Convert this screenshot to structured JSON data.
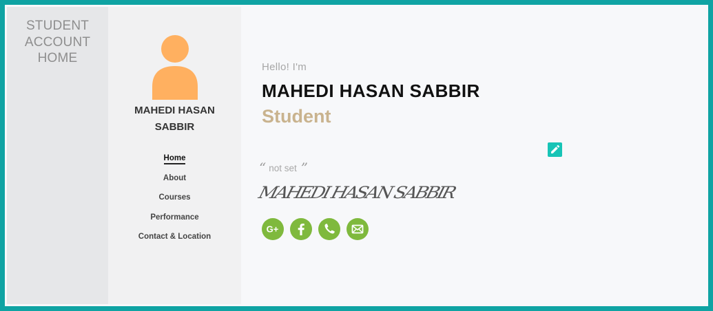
{
  "sidebar": {
    "title": "STUDENT\nACCOUNT\nHOME"
  },
  "profile": {
    "name": "MAHEDI HASAN\nSABBIR",
    "avatar_color": "#ffb060",
    "nav": [
      {
        "label": "Home",
        "active": true
      },
      {
        "label": "About",
        "active": false
      },
      {
        "label": "Courses",
        "active": false
      },
      {
        "label": "Performance",
        "active": false
      },
      {
        "label": "Contact & Location",
        "active": false
      }
    ]
  },
  "main": {
    "greeting": "Hello! I'm",
    "name": "MAHEDI HASAN SABBIR",
    "role": "Student",
    "quote_open": "“",
    "quote_text": "not set",
    "quote_close": "”",
    "signature": "MAHEDI HASAN SABBIR",
    "edit_icon": "pencil-icon",
    "socials": [
      {
        "name": "google-plus-icon"
      },
      {
        "name": "facebook-icon"
      },
      {
        "name": "phone-icon"
      },
      {
        "name": "email-icon"
      }
    ]
  },
  "colors": {
    "frame": "#0fa3a3",
    "accent_green": "#7fb93d",
    "role_gold": "#c9b38e",
    "edit_teal": "#17c4b6"
  }
}
